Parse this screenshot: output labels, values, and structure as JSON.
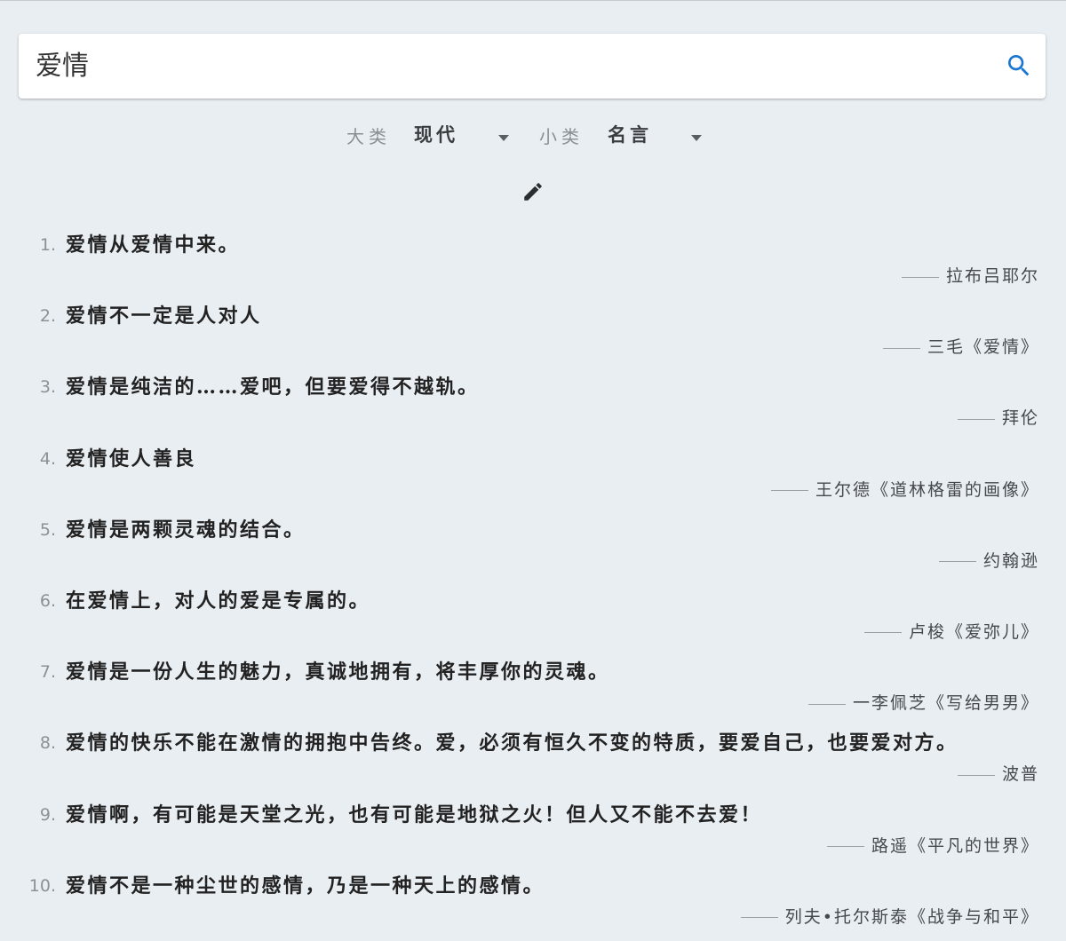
{
  "search": {
    "value": "爱情",
    "icon": "search-icon",
    "icon_color": "#1976d2"
  },
  "filters": {
    "category": {
      "label": "大类",
      "value": "现代"
    },
    "subcategory": {
      "label": "小类",
      "value": "名言"
    }
  },
  "edit_icon": "pencil-icon",
  "quotes": [
    {
      "number": "1.",
      "text": "爱情从爱情中来。",
      "author": "拉布吕耶尔"
    },
    {
      "number": "2.",
      "text": "爱情不一定是人对人",
      "author": "三毛《爱情》"
    },
    {
      "number": "3.",
      "text": "爱情是纯洁的……爱吧，但要爱得不越轨。",
      "author": "拜伦"
    },
    {
      "number": "4.",
      "text": "爱情使人善良",
      "author": "王尔德《道林格雷的画像》"
    },
    {
      "number": "5.",
      "text": "爱情是两颗灵魂的结合。",
      "author": "约翰逊"
    },
    {
      "number": "6.",
      "text": "在爱情上，对人的爱是专属的。",
      "author": "卢梭《爱弥儿》"
    },
    {
      "number": "7.",
      "text": "爱情是一份人生的魅力，真诚地拥有，将丰厚你的灵魂。",
      "author": "一李佩芝《写给男男》"
    },
    {
      "number": "8.",
      "text": "爱情的快乐不能在激情的拥抱中告终。爱，必须有恒久不变的特质，要爱自己，也要爱对方。",
      "author": "波普"
    },
    {
      "number": "9.",
      "text": "爱情啊，有可能是天堂之光，也有可能是地狱之火！但人又不能不去爱！",
      "author": "路遥《平凡的世界》"
    },
    {
      "number": "10.",
      "text": "爱情不是一种尘世的感情，乃是一种天上的感情。",
      "author": "列夫•托尔斯泰《战争与和平》"
    }
  ]
}
